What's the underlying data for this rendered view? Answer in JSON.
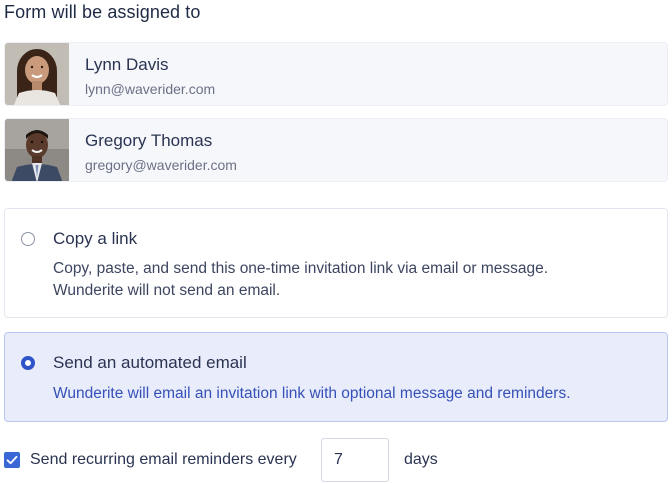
{
  "heading": "Form will be assigned to",
  "assignees": [
    {
      "name": "Lynn Davis",
      "email": "lynn@waverider.com",
      "avatar_icon": "person-photo-woman"
    },
    {
      "name": "Gregory Thomas",
      "email": "gregory@waverider.com",
      "avatar_icon": "person-photo-man"
    }
  ],
  "options": [
    {
      "title": "Copy a link",
      "description_line1": "Copy, paste, and send this one-time invitation link via email or message.",
      "description_line2": "Wunderite will not send an email.",
      "selected": false
    },
    {
      "title": "Send an automated email",
      "description": "Wunderite will email an invitation link with optional message and reminders.",
      "selected": true
    }
  ],
  "reminders": {
    "checked": true,
    "label": "Send recurring email reminders every",
    "value": "7",
    "unit": "days"
  },
  "colors": {
    "accent": "#2f54c9",
    "selected_bg": "#e9edfb",
    "card_bg": "#f6f7fb"
  }
}
